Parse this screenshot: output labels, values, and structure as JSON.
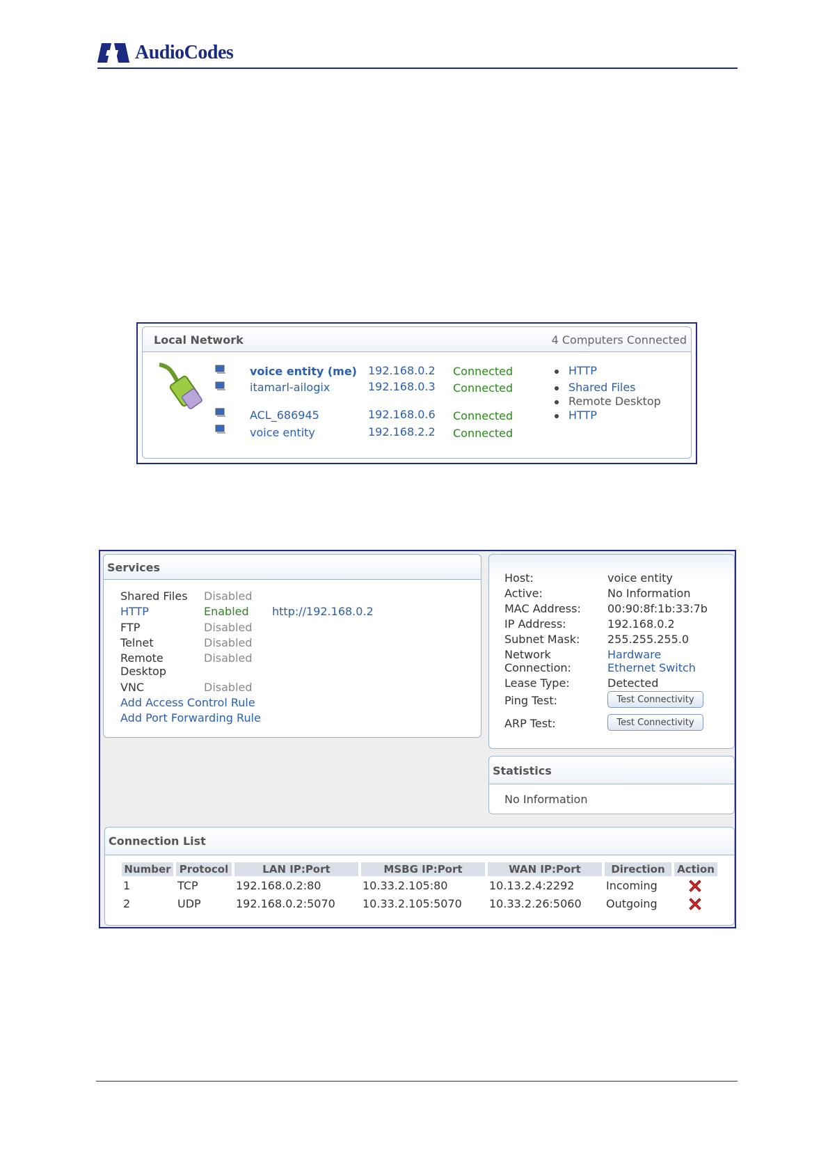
{
  "header": {
    "brand": "AudioCodes"
  },
  "local_network": {
    "title": "Local Network",
    "count_label": "4 Computers Connected",
    "computers": [
      {
        "name": "voice entity (me)",
        "ip": "192.168.0.2",
        "status": "Connected"
      },
      {
        "name": "itamarl-ailogix",
        "ip": "192.168.0.3",
        "status": "Connected"
      },
      {
        "name": "ACL_686945",
        "ip": "192.168.0.6",
        "status": "Connected"
      },
      {
        "name": "voice entity",
        "ip": "192.168.2.2",
        "status": "Connected"
      }
    ],
    "services": [
      "HTTP",
      "Shared Files",
      "Remote Desktop",
      "HTTP"
    ]
  },
  "services_panel": {
    "title": "Services",
    "rows": [
      {
        "name": "Shared Files",
        "state": "Disabled",
        "url": ""
      },
      {
        "name": "HTTP",
        "state": "Enabled",
        "url": "http://192.168.0.2"
      },
      {
        "name": "FTP",
        "state": "Disabled",
        "url": ""
      },
      {
        "name": "Telnet",
        "state": "Disabled",
        "url": ""
      },
      {
        "name_line1": "Remote",
        "name_line2": "Desktop",
        "state": "Disabled",
        "url": ""
      },
      {
        "name": "VNC",
        "state": "Disabled",
        "url": ""
      }
    ],
    "add_access_rule": "Add Access Control Rule",
    "add_port_rule": "Add Port Forwarding Rule"
  },
  "host_panel": {
    "host_label": "Host:",
    "host_value": "voice entity",
    "active_label": "Active:",
    "active_value": "No Information",
    "mac_label": "MAC Address:",
    "mac_value": "00:90:8f:1b:33:7b",
    "ip_label": "IP Address:",
    "ip_value": "192.168.0.2",
    "mask_label": "Subnet Mask:",
    "mask_value": "255.255.255.0",
    "conn_label_1": "Network",
    "conn_label_2": "Connection:",
    "conn_value_1": "Hardware",
    "conn_value_2": "Ethernet Switch",
    "lease_label": "Lease Type:",
    "lease_value": "Detected",
    "ping_label": "Ping Test:",
    "arp_label": "ARP Test:",
    "test_button": "Test Connectivity"
  },
  "statistics": {
    "title": "Statistics",
    "value": "No Information"
  },
  "connection_list": {
    "title": "Connection List",
    "columns": [
      "Number",
      "Protocol",
      "LAN IP:Port",
      "MSBG IP:Port",
      "WAN IP:Port",
      "Direction",
      "Action"
    ],
    "rows": [
      {
        "number": "1",
        "protocol": "TCP",
        "lan": "192.168.0.2:80",
        "msbg": "10.33.2.105:80",
        "wan": "10.13.2.4:2292",
        "direction": "Incoming"
      },
      {
        "number": "2",
        "protocol": "UDP",
        "lan": "192.168.0.2:5070",
        "msbg": "10.33.2.105:5070",
        "wan": "10.33.2.26:5060",
        "direction": "Outgoing"
      }
    ]
  },
  "colors": {
    "brand": "#1a2a80",
    "link": "#2b5fae",
    "connected": "#2a8a1a",
    "disabled": "#888888"
  }
}
